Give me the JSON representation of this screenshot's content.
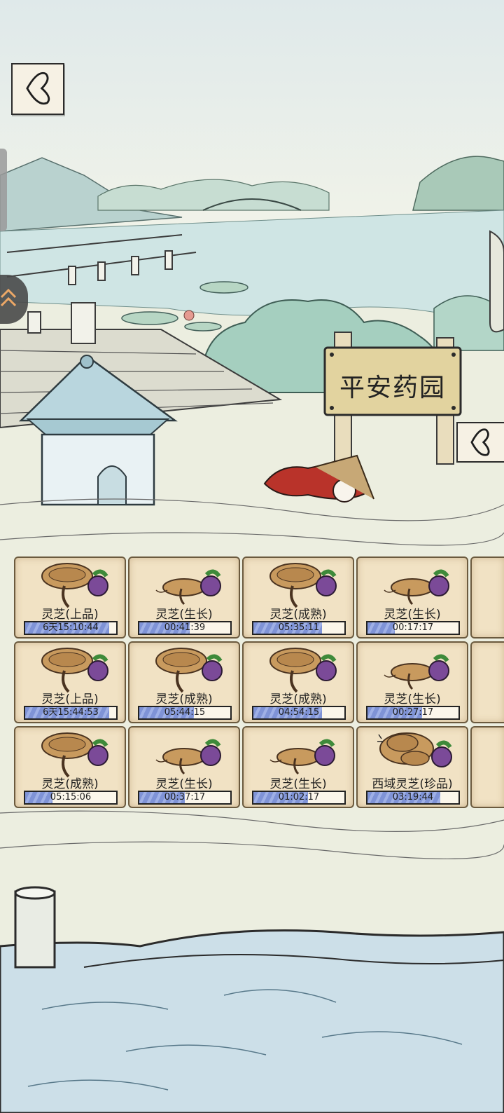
{
  "sign": {
    "title": "平安药园"
  },
  "back_button": {
    "icon": "chevron-left-icon"
  },
  "edge_button": {
    "icon": "chevron-left-icon"
  },
  "plots": [
    {
      "name": "灵芝(上品)",
      "time": "6天15:10:44",
      "progress": 0.92,
      "variant": "large"
    },
    {
      "name": "灵芝(生长)",
      "time": "00:41:39",
      "progress": 0.55,
      "variant": "small"
    },
    {
      "name": "灵芝(成熟)",
      "time": "05:35:11",
      "progress": 0.75,
      "variant": "large"
    },
    {
      "name": "灵芝(生长)",
      "time": "00:17:17",
      "progress": 0.3,
      "variant": "small"
    },
    {
      "name": "灵芝(上品)",
      "time": "6天15:44:53",
      "progress": 0.92,
      "variant": "large"
    },
    {
      "name": "灵芝(成熟)",
      "time": "05:44:15",
      "progress": 0.6,
      "variant": "large"
    },
    {
      "name": "灵芝(成熟)",
      "time": "04:54:15",
      "progress": 0.75,
      "variant": "large"
    },
    {
      "name": "灵芝(生长)",
      "time": "00:27:17",
      "progress": 0.6,
      "variant": "small"
    },
    {
      "name": "灵芝(成熟)",
      "time": "05:15:06",
      "progress": 0.3,
      "variant": "large"
    },
    {
      "name": "灵芝(生长)",
      "time": "00:37:17",
      "progress": 0.5,
      "variant": "small"
    },
    {
      "name": "灵芝(生长)",
      "time": "01:02:17",
      "progress": 0.6,
      "variant": "small"
    },
    {
      "name": "西域灵芝(珍品)",
      "time": "03:19:44",
      "progress": 0.8,
      "variant": "rare"
    }
  ],
  "colors": {
    "progress_fill": "#8ea0de",
    "plot_bg": "#f1e2c4",
    "ink": "#222222"
  }
}
